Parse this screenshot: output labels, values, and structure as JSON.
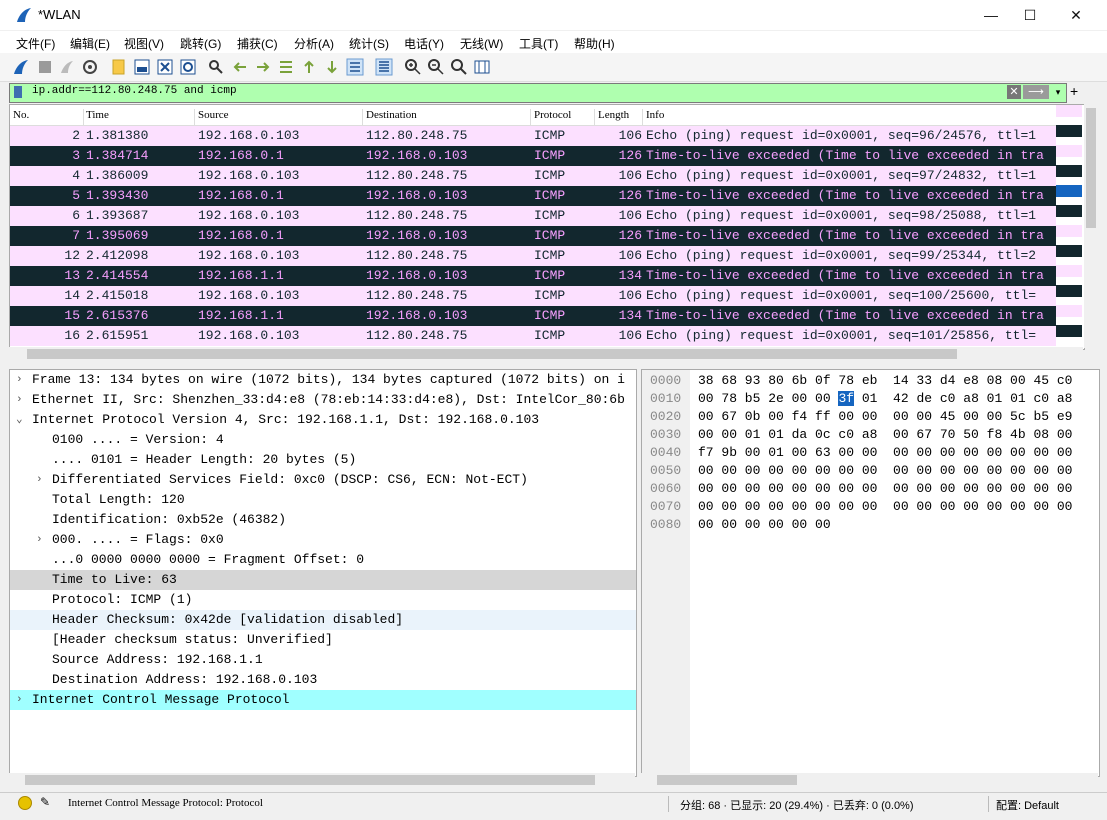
{
  "window": {
    "title": "*WLAN",
    "minimize": "—",
    "maximize": "☐",
    "close": "✕"
  },
  "menu": [
    "文件(F)",
    "编辑(E)",
    "视图(V)",
    "跳转(G)",
    "捕获(C)",
    "分析(A)",
    "统计(S)",
    "电话(Y)",
    "无线(W)",
    "工具(T)",
    "帮助(H)"
  ],
  "toolbar_icons": [
    "shark-start-icon",
    "stop-icon",
    "restart-icon",
    "options-icon",
    "open-file-icon",
    "save-file-icon",
    "close-file-icon",
    "reload-icon",
    "find-icon",
    "go-back-icon",
    "go-forward-icon",
    "go-to-packet-icon",
    "go-first-icon",
    "go-last-icon",
    "autoscroll-icon",
    "colorize-icon",
    "zoom-in-icon",
    "zoom-out-icon",
    "zoom-normal-icon",
    "resize-columns-icon"
  ],
  "filter": {
    "value": "ip.addr==112.80.248.75 and icmp",
    "clear": "✕",
    "apply": "⟶",
    "dropdown": "▾",
    "add": "+"
  },
  "packet_list": {
    "columns": [
      "No.",
      "Time",
      "Source",
      "Destination",
      "Protocol",
      "Length",
      "Info"
    ],
    "rows": [
      {
        "type": "req",
        "no": "2",
        "time": "1.381380",
        "src": "192.168.0.103",
        "dst": "112.80.248.75",
        "proto": "ICMP",
        "len": "106",
        "info": "Echo (ping) request  id=0x0001, seq=96/24576, ttl=1"
      },
      {
        "type": "ttl",
        "no": "3",
        "time": "1.384714",
        "src": "192.168.0.1",
        "dst": "192.168.0.103",
        "proto": "ICMP",
        "len": "126",
        "info": "Time-to-live exceeded (Time to live exceeded in tra"
      },
      {
        "type": "req",
        "no": "4",
        "time": "1.386009",
        "src": "192.168.0.103",
        "dst": "112.80.248.75",
        "proto": "ICMP",
        "len": "106",
        "info": "Echo (ping) request  id=0x0001, seq=97/24832, ttl=1"
      },
      {
        "type": "ttl",
        "no": "5",
        "time": "1.393430",
        "src": "192.168.0.1",
        "dst": "192.168.0.103",
        "proto": "ICMP",
        "len": "126",
        "info": "Time-to-live exceeded (Time to live exceeded in tra"
      },
      {
        "type": "req",
        "no": "6",
        "time": "1.393687",
        "src": "192.168.0.103",
        "dst": "112.80.248.75",
        "proto": "ICMP",
        "len": "106",
        "info": "Echo (ping) request  id=0x0001, seq=98/25088, ttl=1"
      },
      {
        "type": "ttl",
        "no": "7",
        "time": "1.395069",
        "src": "192.168.0.1",
        "dst": "192.168.0.103",
        "proto": "ICMP",
        "len": "126",
        "info": "Time-to-live exceeded (Time to live exceeded in tra"
      },
      {
        "type": "req",
        "no": "12",
        "time": "2.412098",
        "src": "192.168.0.103",
        "dst": "112.80.248.75",
        "proto": "ICMP",
        "len": "106",
        "info": "Echo (ping) request  id=0x0001, seq=99/25344, ttl=2"
      },
      {
        "type": "ttl",
        "no": "13",
        "time": "2.414554",
        "src": "192.168.1.1",
        "dst": "192.168.0.103",
        "proto": "ICMP",
        "len": "134",
        "info": "Time-to-live exceeded (Time to live exceeded in tra"
      },
      {
        "type": "req",
        "no": "14",
        "time": "2.415018",
        "src": "192.168.0.103",
        "dst": "112.80.248.75",
        "proto": "ICMP",
        "len": "106",
        "info": "Echo (ping) request  id=0x0001, seq=100/25600, ttl="
      },
      {
        "type": "ttl",
        "no": "15",
        "time": "2.615376",
        "src": "192.168.1.1",
        "dst": "192.168.0.103",
        "proto": "ICMP",
        "len": "134",
        "info": "Time-to-live exceeded (Time to live exceeded in tra"
      },
      {
        "type": "req",
        "no": "16",
        "time": "2.615951",
        "src": "192.168.0.103",
        "dst": "112.80.248.75",
        "proto": "ICMP",
        "len": "106",
        "info": "Echo (ping) request  id=0x0001, seq=101/25856, ttl="
      }
    ]
  },
  "details": [
    {
      "indent": 0,
      "arrow": "›",
      "text": "Frame 13: 134 bytes on wire (1072 bits), 134 bytes captured (1072 bits) on i",
      "style": ""
    },
    {
      "indent": 0,
      "arrow": "›",
      "text": "Ethernet II, Src: Shenzhen_33:d4:e8 (78:eb:14:33:d4:e8), Dst: IntelCor_80:6b",
      "style": ""
    },
    {
      "indent": 0,
      "arrow": "⌄",
      "text": "Internet Protocol Version 4, Src: 192.168.1.1, Dst: 192.168.0.103",
      "style": ""
    },
    {
      "indent": 1,
      "arrow": "",
      "text": "0100 .... = Version: 4",
      "style": ""
    },
    {
      "indent": 1,
      "arrow": "",
      "text": ".... 0101 = Header Length: 20 bytes (5)",
      "style": ""
    },
    {
      "indent": 1,
      "arrow": "›",
      "text": "Differentiated Services Field: 0xc0 (DSCP: CS6, ECN: Not-ECT)",
      "style": ""
    },
    {
      "indent": 1,
      "arrow": "",
      "text": "Total Length: 120",
      "style": ""
    },
    {
      "indent": 1,
      "arrow": "",
      "text": "Identification: 0xb52e (46382)",
      "style": ""
    },
    {
      "indent": 1,
      "arrow": "›",
      "text": "000. .... = Flags: 0x0",
      "style": ""
    },
    {
      "indent": 1,
      "arrow": "",
      "text": "...0 0000 0000 0000 = Fragment Offset: 0",
      "style": ""
    },
    {
      "indent": 1,
      "arrow": "",
      "text": "Time to Live: 63",
      "style": "sel"
    },
    {
      "indent": 1,
      "arrow": "",
      "text": "Protocol: ICMP (1)",
      "style": ""
    },
    {
      "indent": 1,
      "arrow": "",
      "text": "Header Checksum: 0x42de [validation disabled]",
      "style": "hl"
    },
    {
      "indent": 1,
      "arrow": "",
      "text": "[Header checksum status: Unverified]",
      "style": ""
    },
    {
      "indent": 1,
      "arrow": "",
      "text": "Source Address: 192.168.1.1",
      "style": ""
    },
    {
      "indent": 1,
      "arrow": "",
      "text": "Destination Address: 192.168.0.103",
      "style": ""
    },
    {
      "indent": 0,
      "arrow": "›",
      "text": "Internet Control Message Protocol",
      "style": "icmp"
    }
  ],
  "bytes": [
    {
      "off": "0000",
      "pre": "38 68 93 80 6b 0f 78 eb  14 33 d4 e8 08 00 45 c0",
      "sel": "",
      "post": ""
    },
    {
      "off": "0010",
      "pre": "00 78 b5 2e 00 00 ",
      "sel": "3f",
      "post": " 01  42 de c0 a8 01 01 c0 a8"
    },
    {
      "off": "0020",
      "pre": "00 67 0b 00 f4 ff 00 00  00 00 45 00 00 5c b5 e9",
      "sel": "",
      "post": ""
    },
    {
      "off": "0030",
      "pre": "00 00 01 01 da 0c c0 a8  00 67 70 50 f8 4b 08 00",
      "sel": "",
      "post": ""
    },
    {
      "off": "0040",
      "pre": "f7 9b 00 01 00 63 00 00  00 00 00 00 00 00 00 00",
      "sel": "",
      "post": ""
    },
    {
      "off": "0050",
      "pre": "00 00 00 00 00 00 00 00  00 00 00 00 00 00 00 00",
      "sel": "",
      "post": ""
    },
    {
      "off": "0060",
      "pre": "00 00 00 00 00 00 00 00  00 00 00 00 00 00 00 00",
      "sel": "",
      "post": ""
    },
    {
      "off": "0070",
      "pre": "00 00 00 00 00 00 00 00  00 00 00 00 00 00 00 00",
      "sel": "",
      "post": ""
    },
    {
      "off": "0080",
      "pre": "00 00 00 00 00 00",
      "sel": "",
      "post": ""
    }
  ],
  "status": {
    "text": "Internet Control Message Protocol: Protocol",
    "stats": "分组: 68 · 已显示: 20 (29.4%) · 已丢弃: 0 (0.0%)",
    "profile": "配置: Default"
  },
  "colors": {
    "request_bg": "#fce0ff",
    "ttl_bg": "#12272e",
    "ttl_fg": "#f7a0ff",
    "filter_ok": "#afffaf",
    "icmp_bg": "#a0ffff",
    "byte_select": "#1565c0"
  }
}
